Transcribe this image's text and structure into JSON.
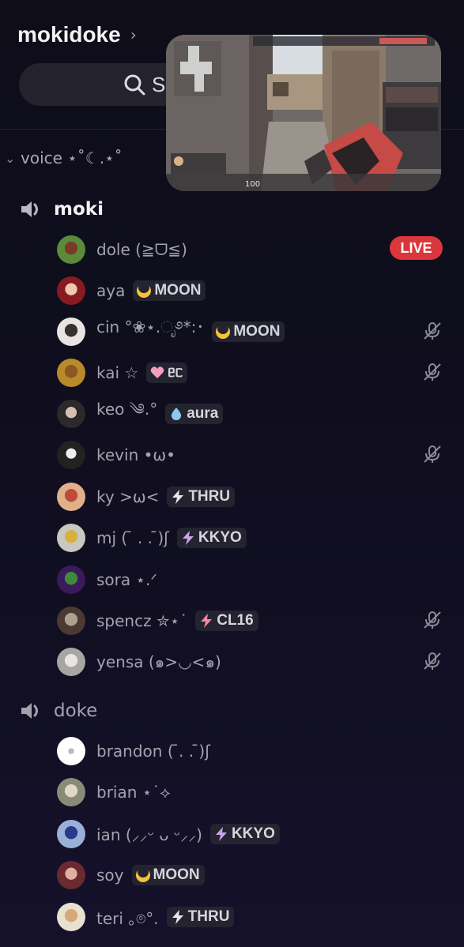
{
  "header": {
    "server_name": "mokidoke",
    "chevron": "chevron-right-icon"
  },
  "search": {
    "text": "S",
    "icon": "search-icon"
  },
  "category": {
    "label": "voice ⋆˚☾.⋆˚",
    "icon": "chevron-down-icon"
  },
  "channels": [
    {
      "name": "moki",
      "icon": "speaker-icon",
      "members": [
        {
          "name": "dole (≧ᗜ≦)",
          "live_badge": "LIVE"
        },
        {
          "name": "aya",
          "tag": "MOON",
          "tag_icon": "moon-icon"
        },
        {
          "name": "cin °❀⋆.ೃ࿔*:･",
          "tag": "MOON",
          "tag_icon": "moon-icon",
          "muted": true
        },
        {
          "name": "kai ☆",
          "tag": "ᥱᥴ",
          "tag_icon": "heart-icon",
          "muted": true
        },
        {
          "name": "keo ༄.°",
          "tag": "aura",
          "tag_icon": "water-drop-icon"
        },
        {
          "name": "kevin •ω•",
          "muted": true
        },
        {
          "name": "ky >ω<",
          "tag": "THRU",
          "tag_icon": "lightning-icon"
        },
        {
          "name": "mj ( ̄ . . ̄)ʃ",
          "tag": "KKYO",
          "tag_icon": "lightning-icon"
        },
        {
          "name": "sora ⋆.ᐟ"
        },
        {
          "name": "spencz ✮⋆˙",
          "tag": "CL16",
          "tag_icon": "lightning-icon",
          "muted": true
        },
        {
          "name": "yensa (๑>◡<๑)",
          "muted": true
        }
      ]
    },
    {
      "name": "doke",
      "icon": "speaker-icon",
      "members": [
        {
          "name": "brandon ( ̄. . ̄)ʃ"
        },
        {
          "name": "brian ⋆˙⟡"
        },
        {
          "name": "ian (⸝⸝ᵕ ᴗ ᵕ⸝⸝)",
          "tag": "KKYO",
          "tag_icon": "lightning-icon"
        },
        {
          "name": "soy",
          "tag": "MOON",
          "tag_icon": "moon-icon"
        },
        {
          "name": "teri ｡⌾°.",
          "tag": "THRU",
          "tag_icon": "lightning-icon"
        }
      ]
    }
  ],
  "colors": {
    "live_red": "#da373c",
    "background": "#0e0d18",
    "muted_icon": "#8a8a95",
    "tag_background": "#242330"
  }
}
